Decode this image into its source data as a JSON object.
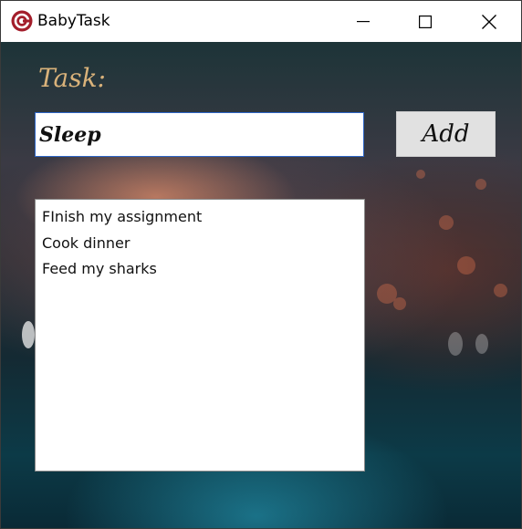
{
  "window": {
    "title": "BabyTask",
    "icon": "babytask-app-icon",
    "controls": [
      "minimize-icon",
      "maximize-icon",
      "close-icon"
    ]
  },
  "form": {
    "label": "Task:",
    "input_value": "Sleep",
    "add_label": "Add"
  },
  "tasks": [
    "FInish my assignment",
    "Cook dinner",
    "Feed my sharks"
  ],
  "colors": {
    "label": "#d9b27a",
    "input_border": "#2e66c7",
    "button_bg": "#e1e1e1",
    "app_icon": "#a31e2b"
  }
}
